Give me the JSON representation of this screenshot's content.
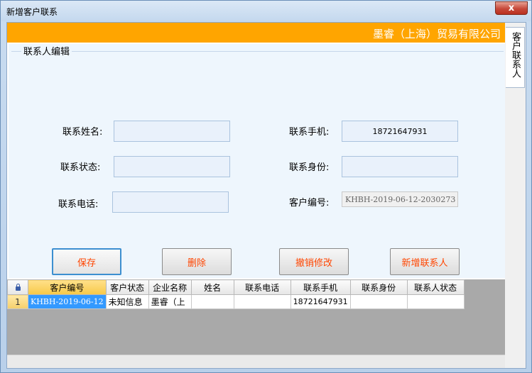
{
  "window": {
    "title": "新增客户联系",
    "close_glyph": "x"
  },
  "banner": {
    "company": "墨睿（上海）贸易有限公司"
  },
  "side_tab": {
    "label": "客户联系人"
  },
  "form": {
    "group_title": "联系人编辑",
    "fields": {
      "name": {
        "label": "联系姓名:",
        "value": ""
      },
      "status": {
        "label": "联系状态:",
        "value": ""
      },
      "phone": {
        "label": "联系电话:",
        "value": ""
      },
      "mobile": {
        "label": "联系手机:",
        "value": "18721647931"
      },
      "identity": {
        "label": "联系身份:",
        "value": ""
      },
      "customer_no": {
        "label": "客户编号:",
        "value": "KHBH-2019-06-12-2030273"
      }
    }
  },
  "buttons": {
    "save": "保存",
    "delete": "删除",
    "undo": "撤销修改",
    "add": "新增联系人"
  },
  "grid": {
    "columns": [
      "客户编号",
      "客户状态",
      "企业名称",
      "姓名",
      "联系电话",
      "联系手机",
      "联系身份",
      "联系人状态"
    ],
    "rows": [
      {
        "num": "1",
        "cells": [
          "KHBH-2019-06-12",
          "未知信息",
          "墨睿（上",
          "",
          "",
          "18721647931",
          "",
          ""
        ]
      }
    ]
  }
}
